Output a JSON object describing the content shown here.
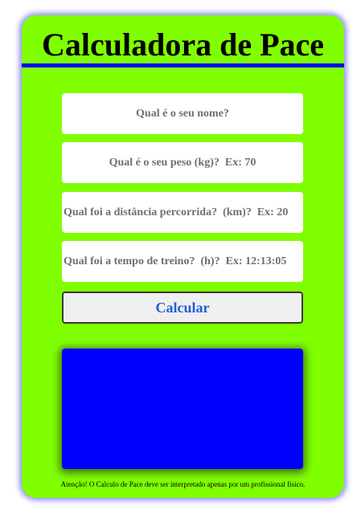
{
  "header": {
    "title": "Calculadora de Pace"
  },
  "form": {
    "name_placeholder": "Qual é o seu nome?",
    "weight_placeholder": "Qual é o seu peso (kg)?  Ex: 70",
    "distance_placeholder": "Qual foi a distância percorrida?  (km)?  Ex: 20",
    "time_placeholder": "Qual foi a tempo de treino?  (h)?  Ex: 12:13:05",
    "submit_label": "Calcular"
  },
  "result": {
    "text": ""
  },
  "footer": {
    "note": "Atenção! O Calculo de Pace deve ser interpretado apenas por um profissional físico."
  },
  "colors": {
    "card_background": "#80ff00",
    "title_bar": "#0000ff",
    "result_box": "#0000ff",
    "button_text": "#1f5fd6",
    "card_glow": "#8f8fff"
  }
}
